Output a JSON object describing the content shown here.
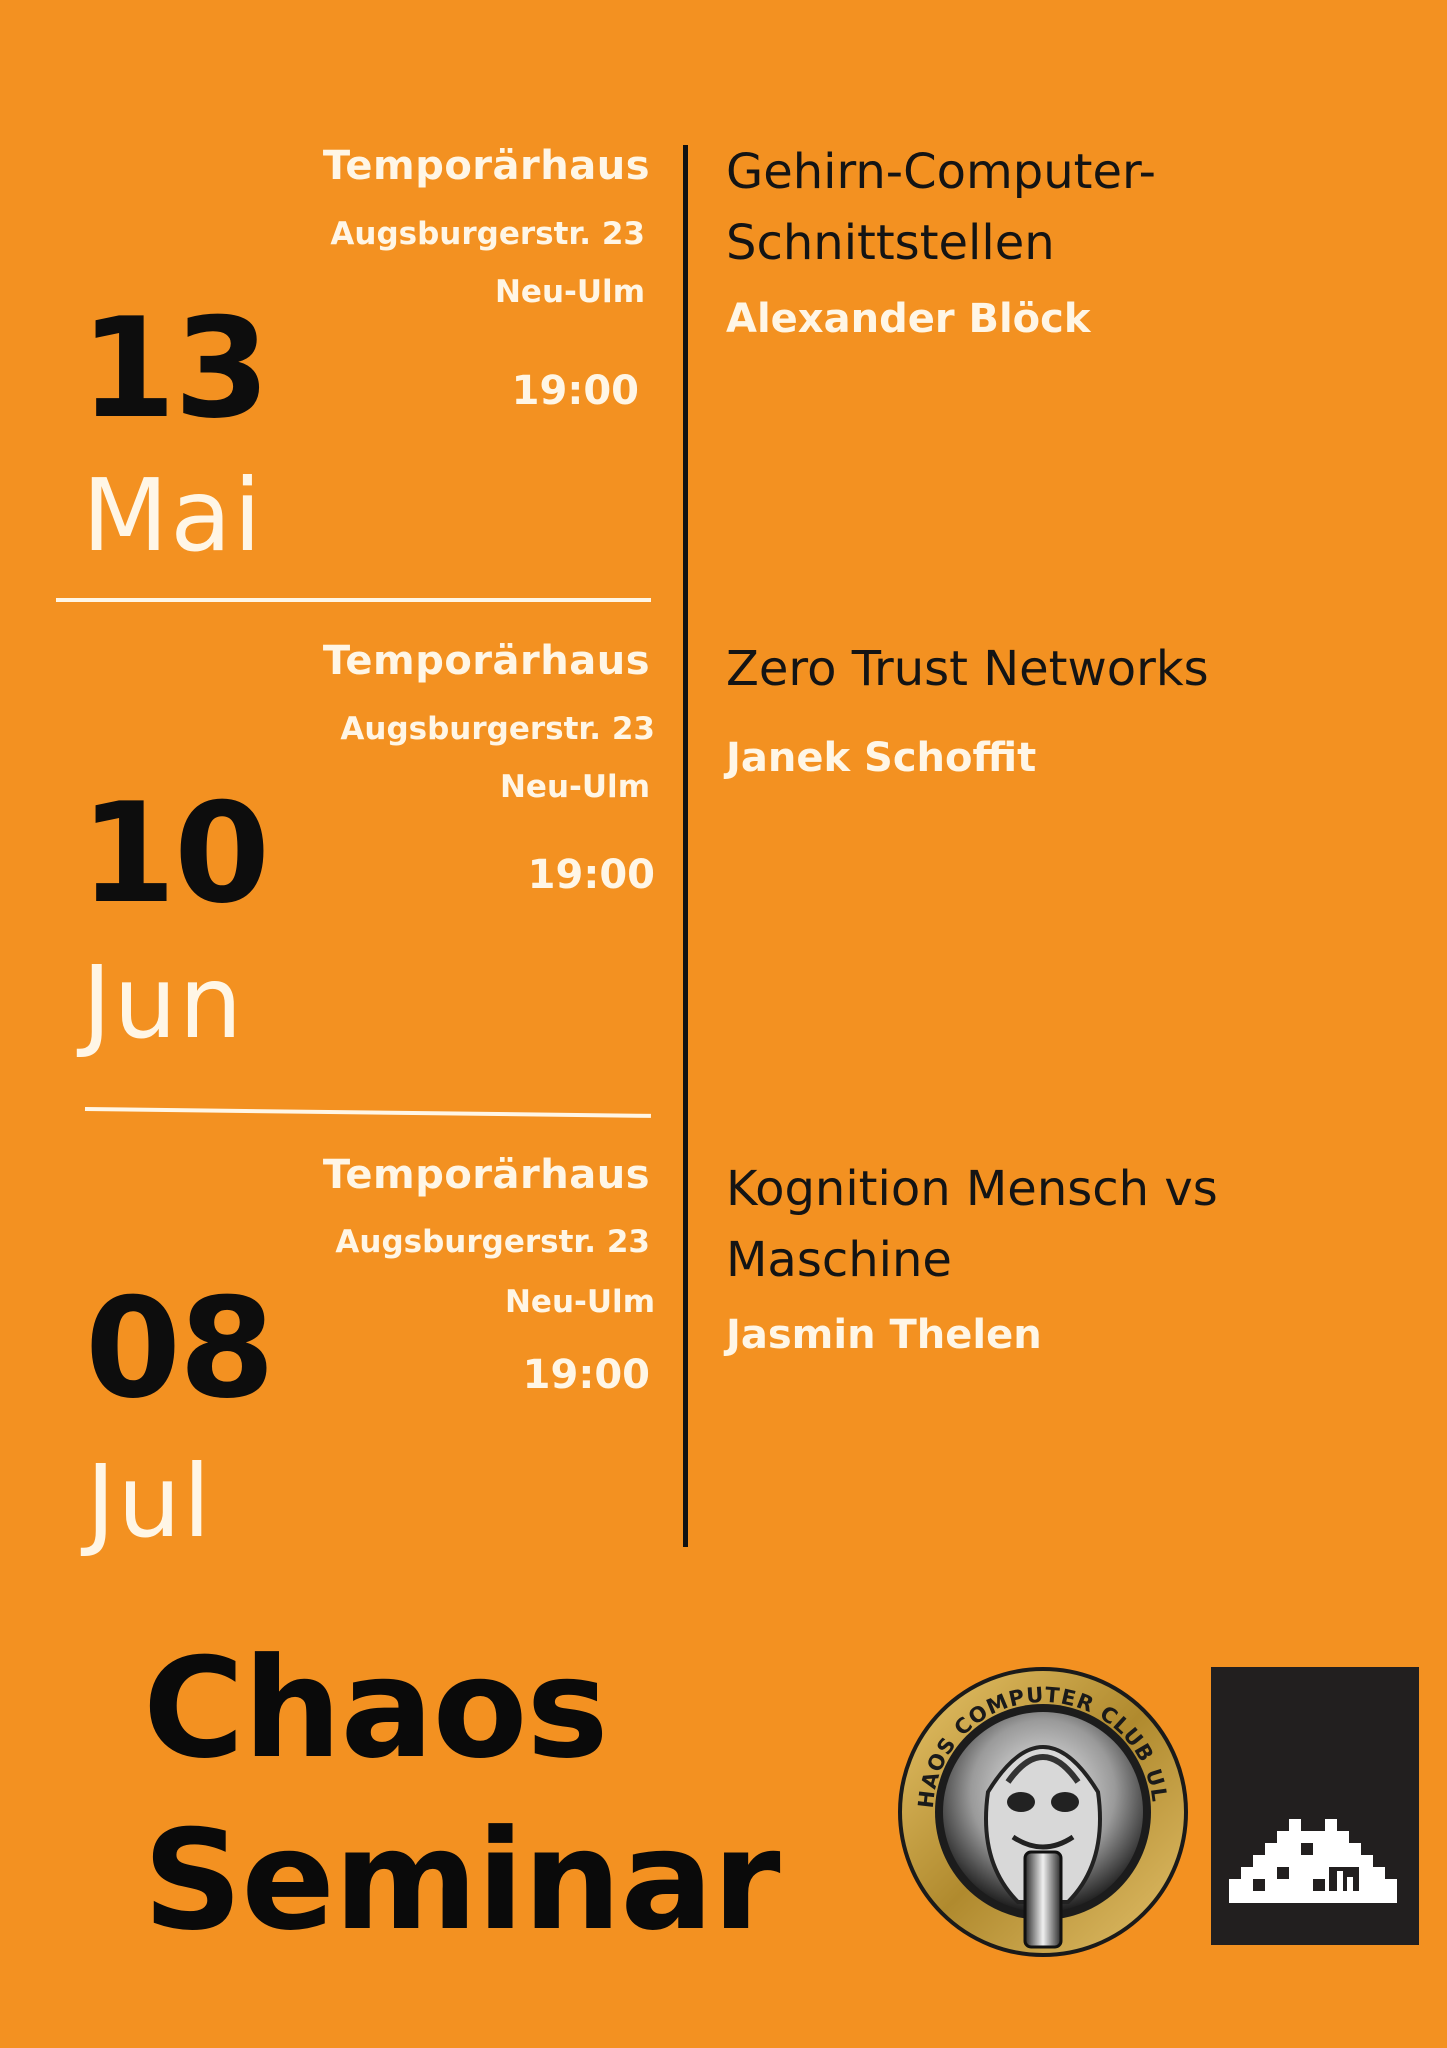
{
  "events": [
    {
      "venue": "Temporärhaus",
      "street": "Augsburgerstr. 23",
      "city": "Neu-Ulm",
      "time": "19:00",
      "day": "13",
      "month": "Mai",
      "title": "Gehirn-Computer-Schnittstellen",
      "speaker": "Alexander Blöck"
    },
    {
      "venue": "Temporärhaus",
      "street": "Augsburgerstr. 23",
      "city": "Neu-Ulm",
      "time": "19:00",
      "day": "10",
      "month": "Jun",
      "title": "Zero Trust Networks",
      "speaker": "Janek Schoffit"
    },
    {
      "venue": "Temporärhaus",
      "street": "Augsburgerstr. 23",
      "city": "Neu-Ulm",
      "time": "19:00",
      "day": "08",
      "month": "Jul",
      "title": "Kognition Mensch vs Maschine",
      "speaker": "Jasmin Thelen"
    }
  ],
  "footer": {
    "title_line1": "Chaos",
    "title_line2": "Seminar"
  },
  "logos": {
    "ccc_ring_text": "CHAOS COMPUTER CLUB ULM"
  },
  "colors": {
    "background": "#f39121",
    "text_dark": "#111111",
    "text_light": "#fff6e6"
  }
}
